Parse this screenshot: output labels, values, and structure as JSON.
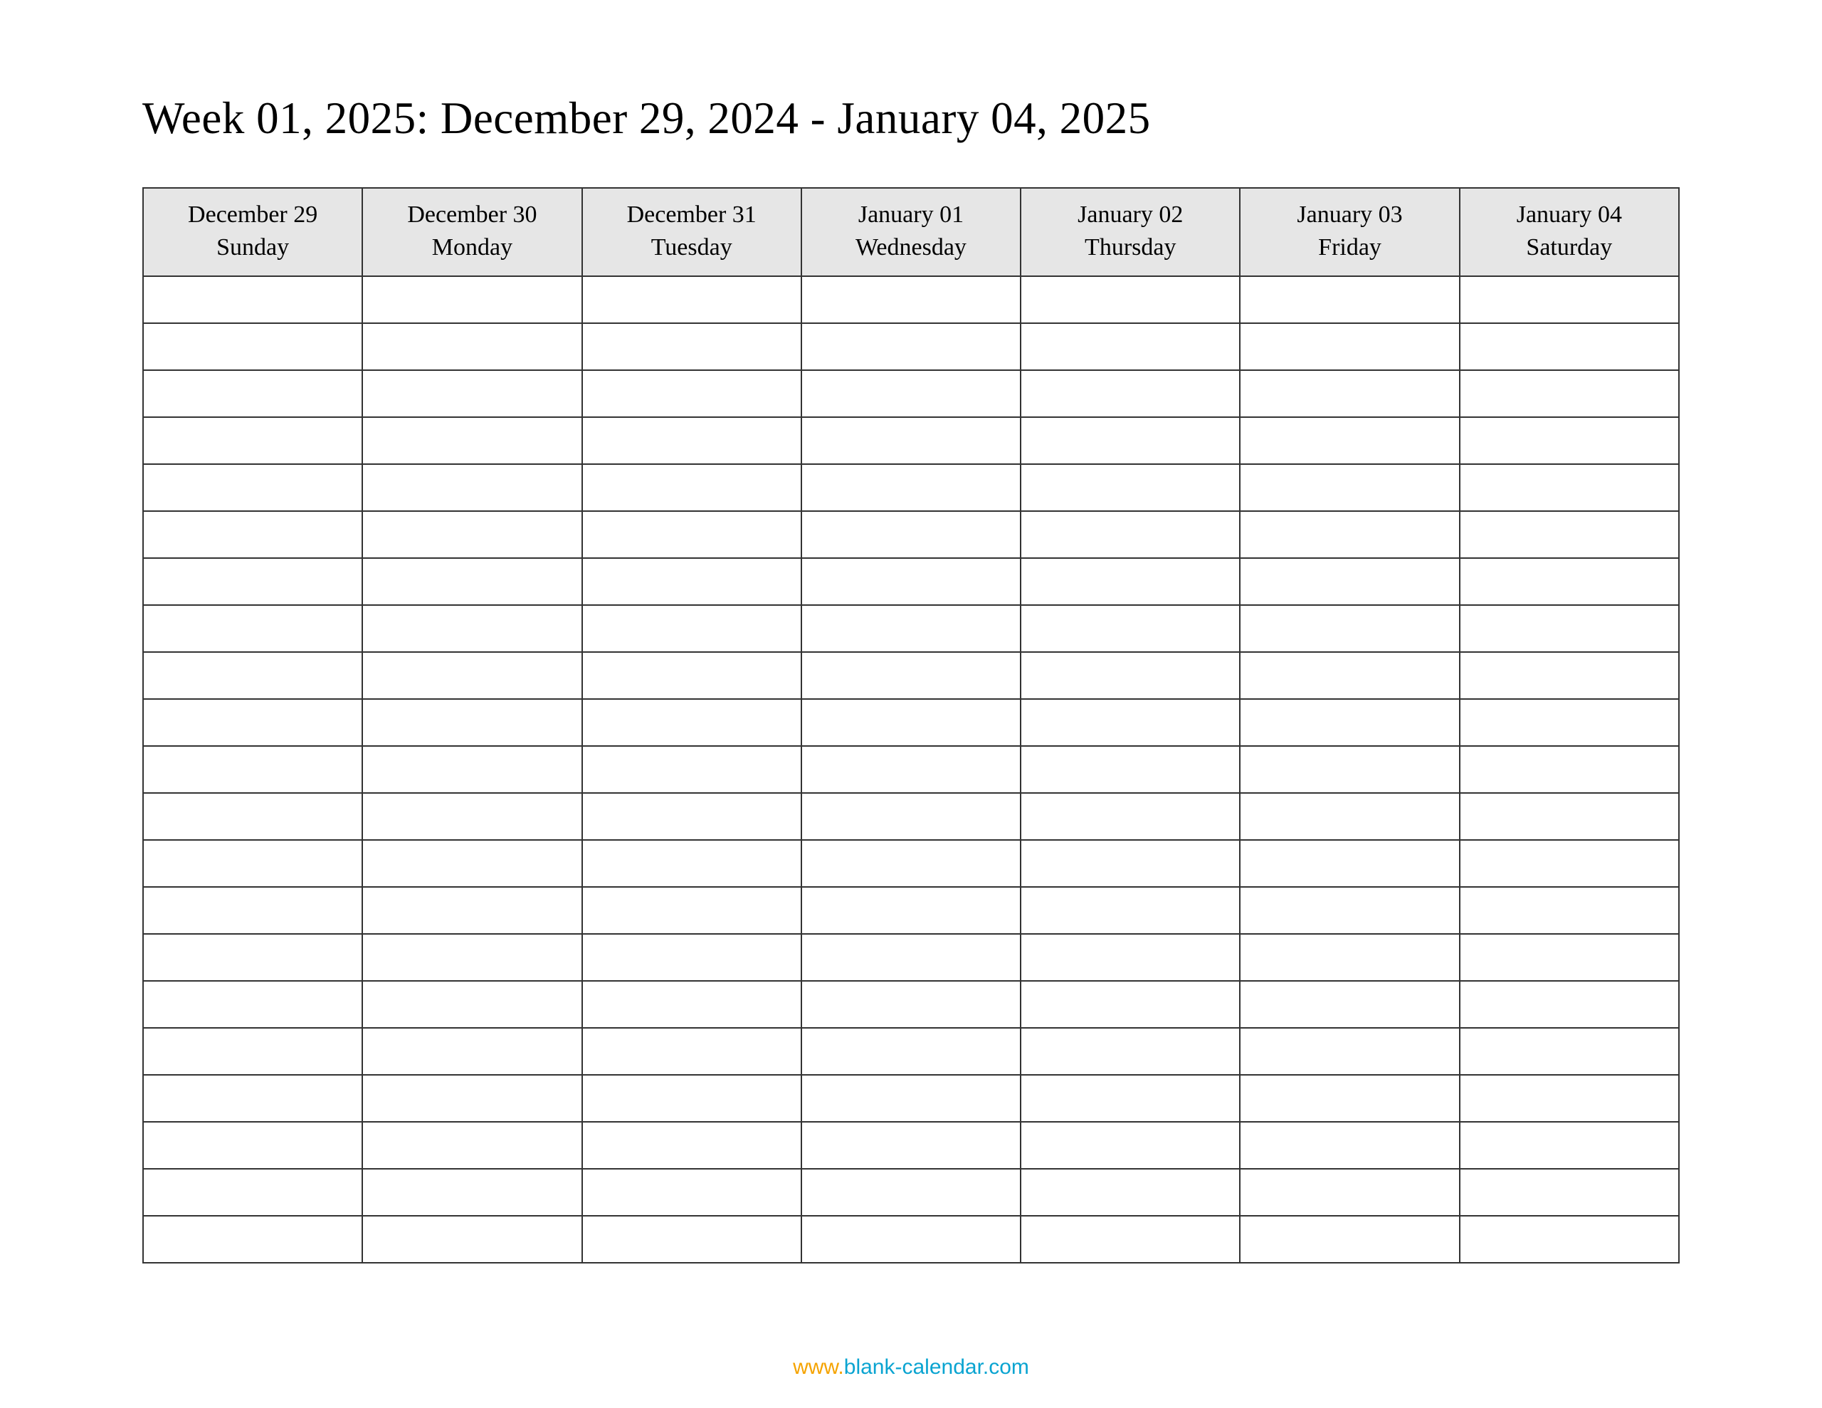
{
  "title": "Week 01, 2025: December 29, 2024 - January 04, 2025",
  "columns": [
    {
      "date": "December 29",
      "day": "Sunday"
    },
    {
      "date": "December 30",
      "day": "Monday"
    },
    {
      "date": "December 31",
      "day": "Tuesday"
    },
    {
      "date": "January 01",
      "day": "Wednesday"
    },
    {
      "date": "January 02",
      "day": "Thursday"
    },
    {
      "date": "January 03",
      "day": "Friday"
    },
    {
      "date": "January 04",
      "day": "Saturday"
    }
  ],
  "row_count": 21,
  "footer": {
    "prefix": "www.",
    "site": "blank-calendar.com"
  }
}
